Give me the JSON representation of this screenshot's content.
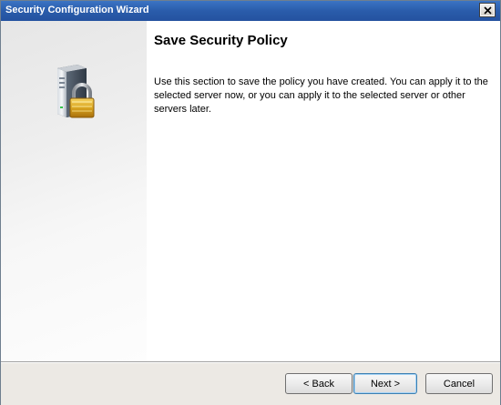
{
  "window": {
    "title": "Security Configuration Wizard",
    "close_label": "Close"
  },
  "left_panel": {
    "icon": "server-lock-icon"
  },
  "content": {
    "heading": "Save Security Policy",
    "description": "Use this section to save the policy you have created. You can apply it to the selected server now, or you can apply it to the selected server or other servers later."
  },
  "footer": {
    "back_label": "< Back",
    "next_label": "Next >",
    "cancel_label": "Cancel"
  },
  "colors": {
    "titlebar": "#2a5cab",
    "footer_bg": "#ece9e4"
  }
}
